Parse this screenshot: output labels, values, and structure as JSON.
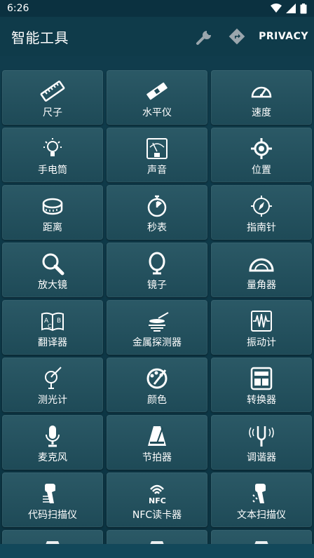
{
  "status": {
    "time": "6:26"
  },
  "appbar": {
    "title": "智能工具",
    "privacy": "PRIVACY"
  },
  "tools": [
    {
      "label": "尺子",
      "icon": "ruler-icon"
    },
    {
      "label": "水平仪",
      "icon": "level-icon"
    },
    {
      "label": "速度",
      "icon": "speedometer-icon"
    },
    {
      "label": "手电筒",
      "icon": "flashlight-bulb-icon"
    },
    {
      "label": "声音",
      "icon": "sound-meter-icon"
    },
    {
      "label": "位置",
      "icon": "location-crosshair-icon"
    },
    {
      "label": "距离",
      "icon": "tape-measure-icon"
    },
    {
      "label": "秒表",
      "icon": "stopwatch-icon"
    },
    {
      "label": "指南针",
      "icon": "compass-icon"
    },
    {
      "label": "放大镜",
      "icon": "magnifier-icon"
    },
    {
      "label": "镜子",
      "icon": "mirror-icon"
    },
    {
      "label": "量角器",
      "icon": "protractor-icon"
    },
    {
      "label": "翻译器",
      "icon": "translator-book-icon"
    },
    {
      "label": "金属探测器",
      "icon": "metal-detector-icon"
    },
    {
      "label": "振动计",
      "icon": "vibration-meter-icon"
    },
    {
      "label": "测光计",
      "icon": "light-meter-icon"
    },
    {
      "label": "颜色",
      "icon": "color-palette-icon"
    },
    {
      "label": "转换器",
      "icon": "unit-converter-icon"
    },
    {
      "label": "麦克风",
      "icon": "microphone-icon"
    },
    {
      "label": "节拍器",
      "icon": "metronome-icon"
    },
    {
      "label": "调谐器",
      "icon": "tuning-fork-icon"
    },
    {
      "label": "代码扫描仪",
      "icon": "barcode-scanner-icon"
    },
    {
      "label": "NFC读卡器",
      "icon": "nfc-icon"
    },
    {
      "label": "文本扫描仪",
      "icon": "text-scanner-icon"
    },
    {
      "label": "",
      "icon": "partial-icon"
    },
    {
      "label": "",
      "icon": "partial-icon"
    },
    {
      "label": "",
      "icon": "partial-icon"
    }
  ]
}
